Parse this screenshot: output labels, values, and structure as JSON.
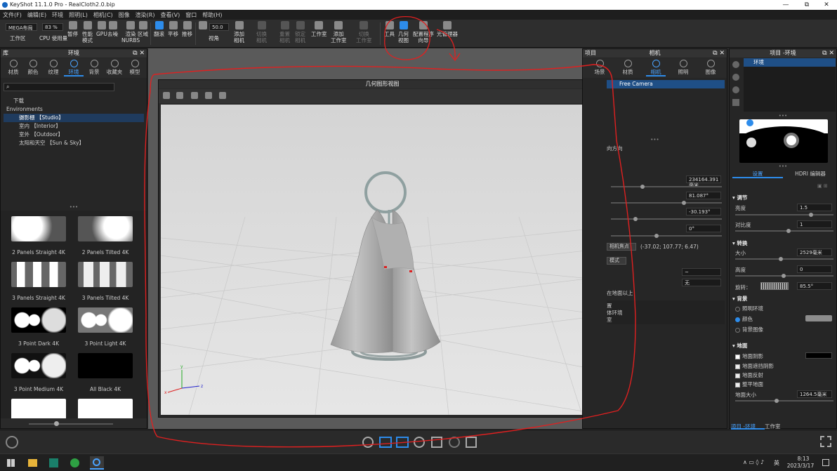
{
  "window": {
    "title": "KeyShot 11.1.0 Pro  - RealCloth2.0.bip",
    "min": "—",
    "max": "⧉",
    "close": "✕"
  },
  "menu": [
    "文件(F)",
    "编辑(E)",
    "环境",
    "照明(L)",
    "相机(C)",
    "图像",
    "渲染(R)",
    "查看(V)",
    "窗口",
    "帮助(H)"
  ],
  "ribbon": {
    "workspace_value": "MEGA布局",
    "workspace_label": "工作区",
    "cpu_value": "83 %",
    "cpu_label": "CPU 使用量",
    "pause": "暂停",
    "perf": "性能\n模式",
    "gpu": "GPU",
    "denoise": "去噪",
    "nurbs": "渲染\nNURBS",
    "region": "区域",
    "tumble": "翻滚",
    "pan": "平移",
    "dolly": "推移",
    "fov_value": "50.0",
    "view_angle": "视角",
    "add_camera": "添加\n相机",
    "switch_camera": "切换\n相机",
    "reset_camera": "重置\n相机",
    "lock_camera": "锁定\n相机",
    "studio": "工作室",
    "add_studio": "添加\n工作室",
    "switch_studio": "切换\n工作室",
    "tools": "工具",
    "geometry_view": "几何\n视图",
    "config_wizard": "配置程序\n向导",
    "light_manager": "光管理器"
  },
  "library": {
    "title": "库",
    "panel_title": "环境",
    "tabs": [
      "材质",
      "颜色",
      "纹理",
      "环境",
      "背景",
      "收藏夹",
      "模型"
    ],
    "tree": [
      "下载",
      "Environments",
      "摄影棚 【Studio】",
      "室内 【Interior】",
      "室外 【Outdoor】",
      "太阳和天空 【Sun & Sky】"
    ],
    "thumbs": [
      "2 Panels Straight 4K",
      "2 Panels Tilted 4K",
      "3 Panels Straight 4K",
      "3 Panels Tilted 4K",
      "3 Point Dark 4K",
      "3 Point Light 4K",
      "3 Point Medium 4K",
      "All Black 4K"
    ]
  },
  "geometry_view": {
    "title": "几何图形视图"
  },
  "project": {
    "title": "项目",
    "panel_title": "相机",
    "tabs": [
      "场景",
      "材质",
      "相机",
      "照明",
      "图像"
    ],
    "camera_item": "Free Camera",
    "section_dir": "向方向",
    "distance": "234164.391毫米",
    "azimuth": "81.087°",
    "inclination": "-30.193°",
    "twist": "0°",
    "focus_button": "相机焦点",
    "focus_coords": "(-37.02; 107.77; 6.47)",
    "mode_button": "模式",
    "ground_text": "在地面以上",
    "dropdown_1": "~",
    "dropdown_2": "无",
    "setting_text": "置",
    "env_text": "体环境",
    "reset_text": "室"
  },
  "env_panel": {
    "title": "项目 -环境",
    "item": "环境",
    "tab_settings": "设置",
    "tab_hdri": "HDRI 编辑器",
    "adjust": "调节",
    "brightness_label": "亮度",
    "brightness": "1.5",
    "contrast_label": "对比度",
    "contrast": "1",
    "transform": "转换",
    "size_label": "大小",
    "size": "2529毫米",
    "height_label": "高度",
    "height": "0",
    "rotation_label": "旋转：",
    "rotation": "85.5°",
    "background": "背景",
    "bg_options": [
      "照明环境",
      "颜色",
      "背景图像"
    ],
    "ground": "地面",
    "ground_options": [
      "地面阴影",
      "地面遮挡阴影",
      "地面反射",
      "整平地面"
    ],
    "ground_size_label": "地面大小",
    "ground_size": "1264.5毫米",
    "bottom_tabs": [
      "项目 -环境",
      "工作室"
    ]
  },
  "taskbar": {
    "ime": "英",
    "time": "8:13",
    "date": "2023/3/17"
  },
  "colors": {
    "accent": "#2d8ceb",
    "annotation": "#e02020"
  }
}
